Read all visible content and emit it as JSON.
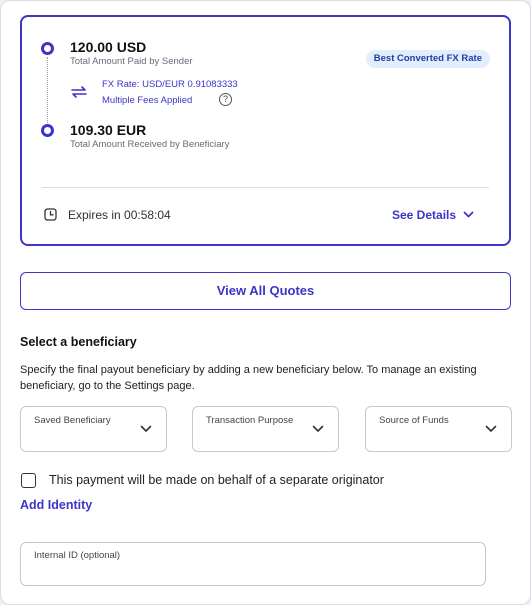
{
  "quote": {
    "sender_amount": "120.00 USD",
    "sender_label": "Total Amount Paid by Sender",
    "badge": "Best Converted FX Rate",
    "fx_rate": "FX Rate: USD/EUR 0.91083333",
    "fees": "Multiple Fees Applied",
    "help_glyph": "?",
    "beneficiary_amount": "109.30 EUR",
    "beneficiary_label": "Total Amount Received by Beneficiary",
    "expires": "Expires in 00:58:04",
    "see_details": "See Details"
  },
  "view_quotes_label": "View All Quotes",
  "beneficiary": {
    "title": "Select a beneficiary",
    "description": "Specify the final payout beneficiary by adding a new beneficiary below. To manage an existing beneficiary, go to the Settings page.",
    "selects": [
      {
        "label": "Saved Beneficiary",
        "value": ""
      },
      {
        "label": "Transaction Purpose",
        "value": ""
      },
      {
        "label": "Source of Funds",
        "value": ""
      }
    ]
  },
  "originator_checkbox": {
    "label": "This payment will be made on behalf of a separate originator",
    "checked": false
  },
  "add_identity_label": "Add Identity",
  "internal_id": {
    "label": "Internal ID (optional)",
    "value": ""
  },
  "icons": {
    "timeline_dot": "ring-icon",
    "fx": "swap-arrows-icon",
    "help": "help-circle-icon",
    "expires": "clock-icon",
    "details": "chevron-down-icon",
    "select": "chevron-down-icon"
  },
  "colors": {
    "accent": "#3d35c6",
    "badge_bg": "#e2eefc",
    "badge_text": "#1f3ea8",
    "border": "#c8c8d0"
  }
}
